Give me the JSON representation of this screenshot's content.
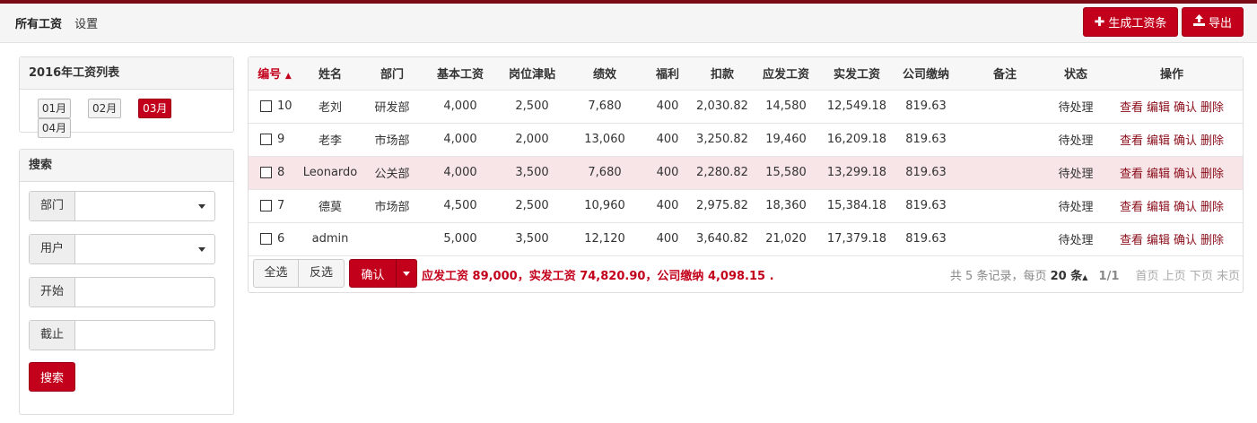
{
  "header": {
    "nav": [
      "所有工资",
      "设置"
    ],
    "generate_label": "生成工资条",
    "export_label": "导出"
  },
  "months_panel": {
    "title": "2016年工资列表",
    "months": [
      "01月",
      "02月",
      "03月",
      "04月"
    ],
    "active_index": 2
  },
  "search_panel": {
    "title": "搜索",
    "fields": [
      {
        "label": "部门",
        "type": "select",
        "value": ""
      },
      {
        "label": "用户",
        "type": "select",
        "value": ""
      },
      {
        "label": "开始",
        "type": "text",
        "value": ""
      },
      {
        "label": "截止",
        "type": "text",
        "value": ""
      }
    ],
    "button": "搜索"
  },
  "table": {
    "columns": [
      "编号",
      "姓名",
      "部门",
      "基本工资",
      "岗位津贴",
      "绩效",
      "福利",
      "扣款",
      "应发工资",
      "实发工资",
      "公司缴纳",
      "备注",
      "状态",
      "操作"
    ],
    "sort_indicator": "▲",
    "rows": [
      {
        "id": "10",
        "name": "老刘",
        "dept": "研发部",
        "base": "4,000",
        "allowance": "2,500",
        "perf": "7,680",
        "welfare": "400",
        "deduct": "2,030.82",
        "gross": "14,580",
        "net": "12,549.18",
        "company": "819.63",
        "note": "",
        "status": "待处理"
      },
      {
        "id": "9",
        "name": "老李",
        "dept": "市场部",
        "base": "4,000",
        "allowance": "2,000",
        "perf": "13,060",
        "welfare": "400",
        "deduct": "3,250.82",
        "gross": "19,460",
        "net": "16,209.18",
        "company": "819.63",
        "note": "",
        "status": "待处理"
      },
      {
        "id": "8",
        "name": "Leonardo",
        "dept": "公关部",
        "base": "4,000",
        "allowance": "3,500",
        "perf": "7,680",
        "welfare": "400",
        "deduct": "2,280.82",
        "gross": "15,580",
        "net": "13,299.18",
        "company": "819.63",
        "note": "",
        "status": "待处理"
      },
      {
        "id": "7",
        "name": "德莫",
        "dept": "市场部",
        "base": "4,500",
        "allowance": "2,500",
        "perf": "10,960",
        "welfare": "400",
        "deduct": "2,975.82",
        "gross": "18,360",
        "net": "15,384.18",
        "company": "819.63",
        "note": "",
        "status": "待处理"
      },
      {
        "id": "6",
        "name": "admin",
        "dept": "",
        "base": "5,000",
        "allowance": "3,500",
        "perf": "12,120",
        "welfare": "400",
        "deduct": "3,640.82",
        "gross": "21,020",
        "net": "17,379.18",
        "company": "819.63",
        "note": "",
        "status": "待处理"
      }
    ],
    "highlighted_row": 2,
    "actions": [
      "查看",
      "编辑",
      "确认",
      "删除"
    ]
  },
  "footer": {
    "select_all": "全选",
    "invert": "反选",
    "confirm": "确认",
    "summary": "应发工资 89,000，实发工资 74,820.90，公司缴纳 4,098.15 .",
    "pager_prefix": "共 5 条记录，每页",
    "page_size": "20 条",
    "page_of": "1/1",
    "first": "首页",
    "prev": "上页",
    "next": "下页",
    "last": "末页"
  },
  "colors": {
    "accent": "#c3001c",
    "topbar": "#7a0c16",
    "highlight_row": "#f8e5e8"
  }
}
